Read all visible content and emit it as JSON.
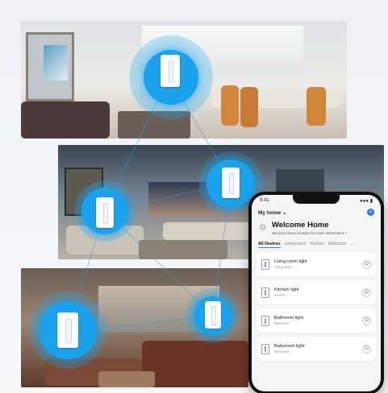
{
  "colors": {
    "accent": "#1aa3ec",
    "app_blue": "#3478f6"
  },
  "phone": {
    "status": {
      "time": "9:41",
      "signal": "●●● ▮"
    },
    "home_selector": "My home ⌄",
    "add_icon": "+",
    "welcome_icon": "sun-icon",
    "welcome_title": "Welcome Home",
    "welcome_subtitle": "Set your home location for more information >",
    "tabs": [
      "All Devices",
      "Living room",
      "Kitchen",
      "Bathroom",
      "···"
    ],
    "devices": [
      {
        "name": "Living room light",
        "room": "Living room"
      },
      {
        "name": "Kitchen light",
        "room": "Kitchen"
      },
      {
        "name": "Bathroom light",
        "room": "Bathroom"
      },
      {
        "name": "Babyroom light",
        "room": "Babyroom"
      }
    ],
    "power_icon": "⏻"
  }
}
